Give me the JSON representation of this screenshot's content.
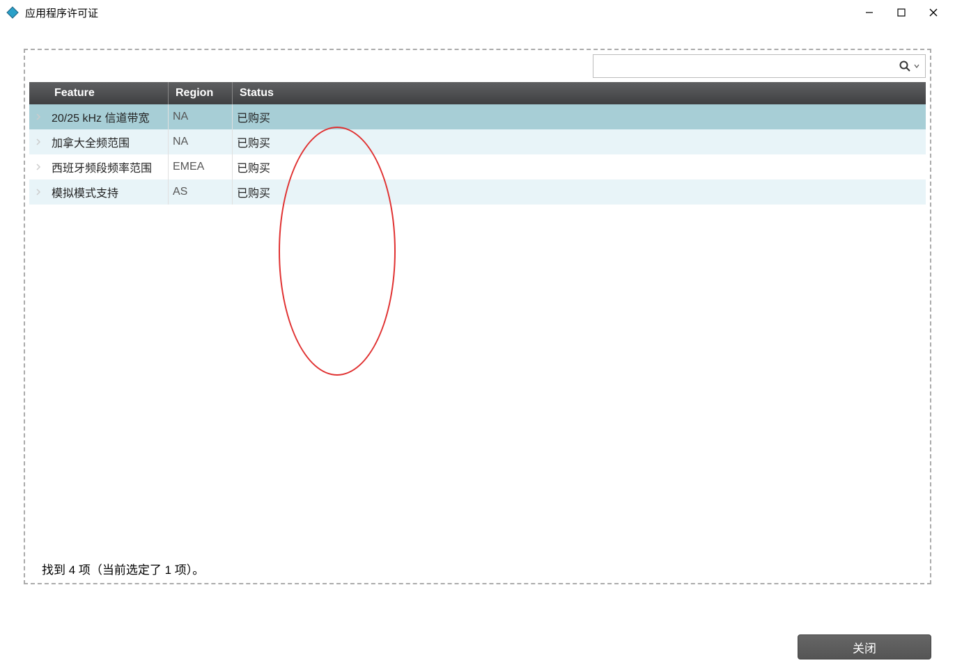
{
  "window": {
    "title": "应用程序许可证"
  },
  "search": {
    "value": "",
    "placeholder": ""
  },
  "table": {
    "headers": {
      "feature": "Feature",
      "region": "Region",
      "status": "Status"
    },
    "rows": [
      {
        "feature": "20/25 kHz 信道带宽",
        "region": "NA",
        "status": "已购买",
        "selected": true
      },
      {
        "feature": "加拿大全频范围",
        "region": "NA",
        "status": "已购买",
        "selected": false
      },
      {
        "feature": "西班牙频段频率范围",
        "region": "EMEA",
        "status": "已购买",
        "selected": false
      },
      {
        "feature": "模拟模式支持",
        "region": "AS",
        "status": "已购买",
        "selected": false
      }
    ]
  },
  "statusbar": "找到 4 项（当前选定了 1 项）。",
  "footer": {
    "close_label": "关闭"
  }
}
